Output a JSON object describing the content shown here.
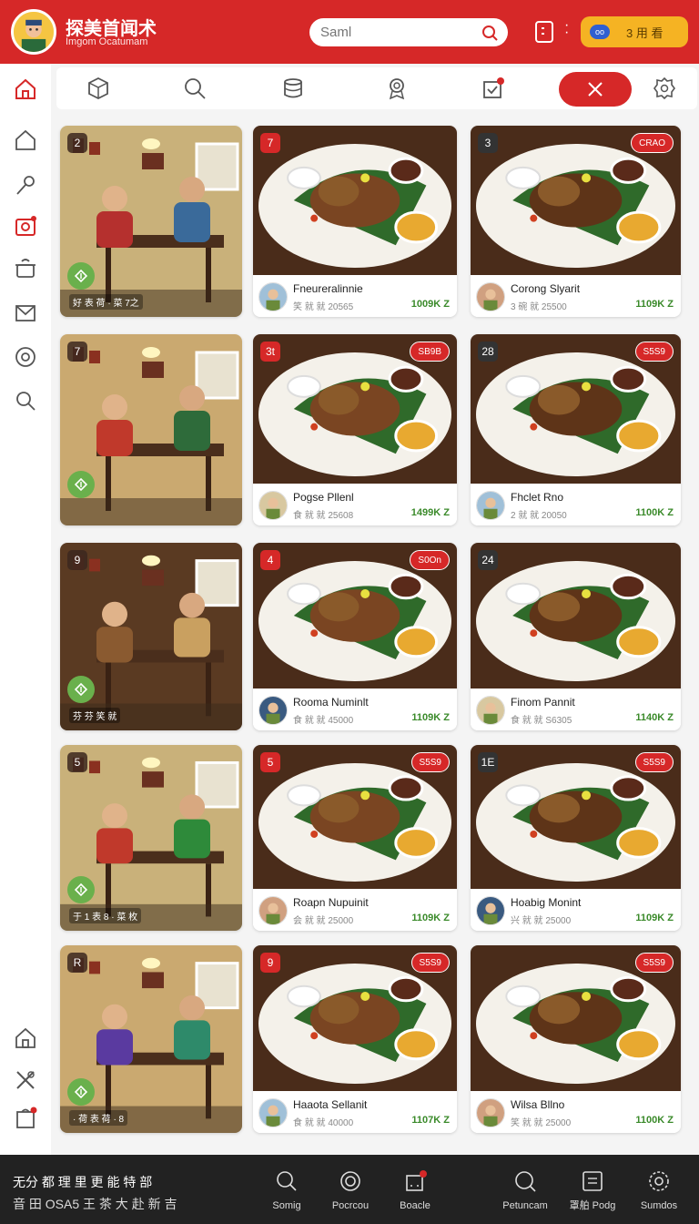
{
  "header": {
    "brand_title": "探美首闻术",
    "brand_subtitle": "Imgom Ocatumam",
    "search_placeholder": "Saml",
    "action_button_label": "3 用 看",
    "action_pill": "oo"
  },
  "colors": {
    "primary_red": "#d62828",
    "accent_yellow": "#f5b323",
    "price_green": "#3a8a2a",
    "fav_green": "#6ab04c",
    "bottom_bar": "#222222"
  },
  "sidebar": {
    "items": [
      {
        "icon": "home-icon",
        "active": true
      },
      {
        "icon": "house-outline-icon"
      },
      {
        "icon": "key-icon"
      },
      {
        "icon": "camera-icon"
      },
      {
        "icon": "pot-icon"
      },
      {
        "icon": "mail-icon"
      },
      {
        "icon": "target-icon"
      },
      {
        "icon": "search-icon"
      },
      {
        "icon": "home-icon"
      },
      {
        "icon": "tools-icon"
      },
      {
        "icon": "cart-badge-icon"
      }
    ]
  },
  "toolbar": {
    "items": [
      {
        "icon": "cube-icon"
      },
      {
        "icon": "search-icon"
      },
      {
        "icon": "database-icon"
      },
      {
        "icon": "medal-icon"
      },
      {
        "icon": "calendar-badge-icon"
      },
      {
        "icon": "close-icon",
        "active": true
      },
      {
        "icon": "settings-icon"
      }
    ]
  },
  "cards": [
    {
      "type": "scene",
      "num": "2",
      "caption": "好 表 荷 · 菜 7之"
    },
    {
      "type": "dish",
      "num": "7",
      "name": "Fneureralinnie",
      "meta": "笑 就 就     20565",
      "price": "1009",
      "price_unit": "K Z"
    },
    {
      "type": "dish",
      "num": "3",
      "tag": "CRAO",
      "name": "Corong Slyarit",
      "meta": "3 碗 就     25500",
      "price": "1109",
      "price_unit": "K Z"
    },
    {
      "type": "scene",
      "num": "7",
      "caption": ""
    },
    {
      "type": "dish",
      "num": "3t",
      "tag": "SB9B",
      "name": "Pogse Pllenl",
      "meta": "食 就 就     25608",
      "price": "1499",
      "price_unit": "K Z"
    },
    {
      "type": "dish",
      "num": "28",
      "tag": "S5S9",
      "name": "Fhclet Rno",
      "meta": "2 就 就     20050",
      "price": "1100",
      "price_unit": "K Z"
    },
    {
      "type": "scene",
      "num": "9",
      "caption": "芬 芬 笑 就"
    },
    {
      "type": "dish",
      "num": "4",
      "tag": "S0On",
      "name": "Rooma Numinlt",
      "meta": "食 就 就     45000",
      "price": "1109",
      "price_unit": "K Z"
    },
    {
      "type": "dish",
      "num": "24",
      "name": "Finom Pannit",
      "meta": "食 就 就     S6305",
      "price": "1140",
      "price_unit": "K Z"
    },
    {
      "type": "scene",
      "num": "5",
      "caption": "于 1 表 8 · 菜 枚"
    },
    {
      "type": "dish",
      "num": "5",
      "tag": "S5S9",
      "name": "Roapn Nupuinit",
      "meta": "会 就 就     25000",
      "price": "1109",
      "price_unit": "K Z"
    },
    {
      "type": "dish",
      "num": "1E",
      "tag": "S5S9",
      "name": "Hoabig Monint",
      "meta": "兴 就 就     25000",
      "price": "1109",
      "price_unit": "K Z"
    },
    {
      "type": "scene",
      "num": "R",
      "caption": "· 荷 表 荷 · 8"
    },
    {
      "type": "dish",
      "num": "9",
      "tag": "S5S9",
      "name": "Haaota Sellanit",
      "meta": "食 就 就     40000",
      "price": "1107",
      "price_unit": "K Z"
    },
    {
      "type": "dish",
      "num": "",
      "tag": "S5S9",
      "name": "Wilsa Bllno",
      "meta": "笑 就 就     25000",
      "price": "1100",
      "price_unit": "K Z"
    }
  ],
  "bottom_bar": {
    "text_line1": "无分 都 理 里 更 能 特 部",
    "text_line2": "音 田 OSA5 王 茶 大 赴 新 吉",
    "items": [
      {
        "icon": "search-icon",
        "label": "Somig"
      },
      {
        "icon": "compass-icon",
        "label": "Pocrcou"
      },
      {
        "icon": "bag-badge-icon",
        "label": "Boacle"
      },
      {
        "icon": "chat-search-icon",
        "label": "Petuncam"
      },
      {
        "icon": "menu-icon",
        "label": "罩舶 Podg"
      },
      {
        "icon": "gear-icon",
        "label": "Sumdos"
      }
    ]
  }
}
